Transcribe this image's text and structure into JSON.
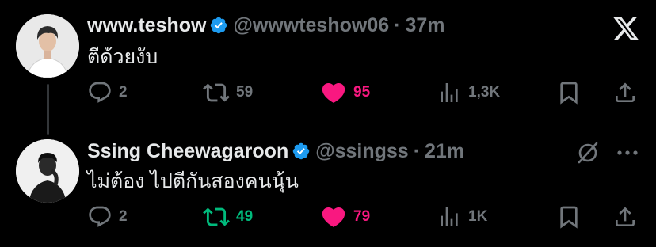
{
  "colors": {
    "background": "#000000",
    "text_primary": "#e7e9ea",
    "text_secondary": "#71767b",
    "verified": "#1d9bf0",
    "like": "#f91880",
    "retweet": "#00ba7c",
    "thread_line": "#333639"
  },
  "tweets": [
    {
      "author": {
        "name": "www.teshow",
        "handle": "@wwwteshow06",
        "verified": true
      },
      "separator": "·",
      "time": "37m",
      "text": "ตีด้วยงับ",
      "top_right_icon": "x-logo-icon",
      "actions": {
        "replies": "2",
        "retweets": "59",
        "retweeted": false,
        "likes": "95",
        "liked": true,
        "views": "1,3K"
      }
    },
    {
      "author": {
        "name": "Ssing Cheewagaroon",
        "handle": "@ssingss",
        "verified": true
      },
      "separator": "·",
      "time": "21m",
      "text": "ไม่ต้อง ไปตีกันสองคนนุ้น",
      "top_right_icons": [
        "grok-icon",
        "more-icon"
      ],
      "actions": {
        "replies": "2",
        "retweets": "49",
        "retweeted": true,
        "likes": "79",
        "liked": true,
        "views": "1K"
      }
    }
  ]
}
